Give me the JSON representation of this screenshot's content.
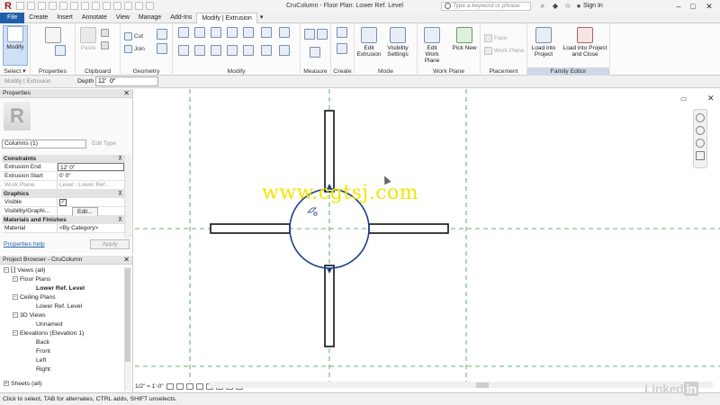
{
  "app": {
    "title": "CruColumn - Floor Plan: Lower Ref. Level",
    "search_placeholder": "Type a keyword or phrase",
    "sign_in": "Sign In",
    "logo": "R"
  },
  "tabs": [
    {
      "label": "File"
    },
    {
      "label": "Create"
    },
    {
      "label": "Insert"
    },
    {
      "label": "Annotate"
    },
    {
      "label": "View"
    },
    {
      "label": "Manage"
    },
    {
      "label": "Add-Ins"
    },
    {
      "label": "Modify | Extrusion"
    }
  ],
  "ribbon": {
    "select": {
      "button": "Modify",
      "label": "Select ▾"
    },
    "properties": {
      "label": "Properties"
    },
    "clipboard": {
      "paste": "Paste",
      "cut": "Cut",
      "copy": "Copy",
      "join": "Join",
      "label": "Clipboard"
    },
    "geometry": {
      "label": "Geometry"
    },
    "modify": {
      "label": "Modify"
    },
    "measure": {
      "label": "Measure"
    },
    "create": {
      "label": "Create"
    },
    "mode": {
      "edit_extrusion": "Edit Extrusion",
      "visibility_settings": "Visibility Settings",
      "label": "Mode"
    },
    "work_plane": {
      "edit_work_plane": "Edit Work Plane",
      "pick_new": "Pick New",
      "label": "Work Plane"
    },
    "placement": {
      "face": "Face",
      "work_plane": "Work Plane",
      "label": "Placement"
    },
    "family_editor": {
      "load_project": "Load into Project",
      "load_close": "Load into Project and Close",
      "label": "Family Editor"
    }
  },
  "options_bar": {
    "context": "Modify | Extrusion",
    "depth_label": "Depth",
    "depth_value": "12'  0\""
  },
  "properties": {
    "title": "Properties",
    "type_selector": "Columns (1)",
    "edit_type": "Edit Type",
    "sections": {
      "constraints": "Constraints",
      "graphics": "Graphics",
      "materials": "Materials and Finishes"
    },
    "rows": {
      "extrusion_end": {
        "key": "Extrusion End",
        "value": "12'  0\""
      },
      "extrusion_start": {
        "key": "Extrusion Start",
        "value": "0'  0\""
      },
      "work_plane": {
        "key": "Work Plane",
        "value": "Level : Lower Ref..."
      },
      "visible": {
        "key": "Visible",
        "value": "✓"
      },
      "visibility": {
        "key": "Visibility/Graphi...",
        "value": "Edit..."
      },
      "material": {
        "key": "Material",
        "value": "<By Category>"
      }
    },
    "help": "Properties help",
    "apply": "Apply"
  },
  "browser": {
    "title": "Project Browser - CruColumn",
    "items": [
      {
        "label": "Views (all)",
        "level": 0,
        "toggle": "−"
      },
      {
        "label": "Floor Plans",
        "level": 1,
        "toggle": "−"
      },
      {
        "label": "Lower Ref. Level",
        "level": 2,
        "bold": true
      },
      {
        "label": "Ceiling Plans",
        "level": 1,
        "toggle": "−"
      },
      {
        "label": "Lower Ref. Level",
        "level": 2
      },
      {
        "label": "3D Views",
        "level": 1,
        "toggle": "−"
      },
      {
        "label": "Unnamed",
        "level": 2
      },
      {
        "label": "Elevations (Elevation 1)",
        "level": 1,
        "toggle": "−"
      },
      {
        "label": "Back",
        "level": 2
      },
      {
        "label": "Front",
        "level": 2
      },
      {
        "label": "Left",
        "level": 2
      },
      {
        "label": "Right",
        "level": 2
      },
      {
        "label": "Sheets (all)",
        "level": 0
      }
    ]
  },
  "view_control": {
    "scale": "1/2\" = 1'-0\""
  },
  "status_bar": {
    "text": "Click to select, TAB for alternates, CTRL adds, SHIFT unselects."
  },
  "overlays": {
    "watermark": "www.cgtsj.com",
    "brand": "Linked",
    "brand_in": "in"
  },
  "colors": {
    "accent": "#1f5fa8",
    "ref_plane": "#2e9a3a",
    "sketch": "#1e3f8c",
    "watermark": "#f2e600"
  }
}
